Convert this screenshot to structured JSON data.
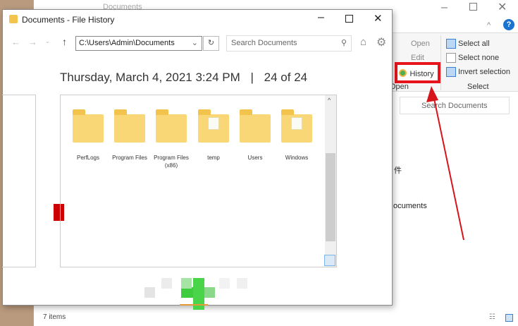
{
  "background_window": {
    "title": "Documents",
    "ribbon": {
      "open": "Open",
      "edit": "Edit",
      "history": "History",
      "open_group": "Open",
      "select_all": "Select all",
      "select_none": "Select none",
      "invert_selection": "Invert selection",
      "select_group": "Select"
    },
    "search_placeholder": "Search Documents",
    "nav_items": [
      "件",
      "ocuments"
    ],
    "status": "7 items"
  },
  "file_history": {
    "title": "Documents - File History",
    "address": "C:\\Users\\Admin\\Documents",
    "search_placeholder": "Search Documents",
    "date": "Thursday, March 4, 2021 3:24 PM",
    "separator": "|",
    "version": "24 of 24",
    "folders": [
      {
        "name": "PerfLogs",
        "has_contents": false
      },
      {
        "name": "Program Files",
        "has_contents": false
      },
      {
        "name": "Program Files (x86)",
        "has_contents": false
      },
      {
        "name": "temp",
        "has_contents": true
      },
      {
        "name": "Users",
        "has_contents": false
      },
      {
        "name": "Windows",
        "has_contents": true
      }
    ]
  },
  "colors": {
    "highlight": "#e8141b",
    "restore": "#3cc43c"
  }
}
